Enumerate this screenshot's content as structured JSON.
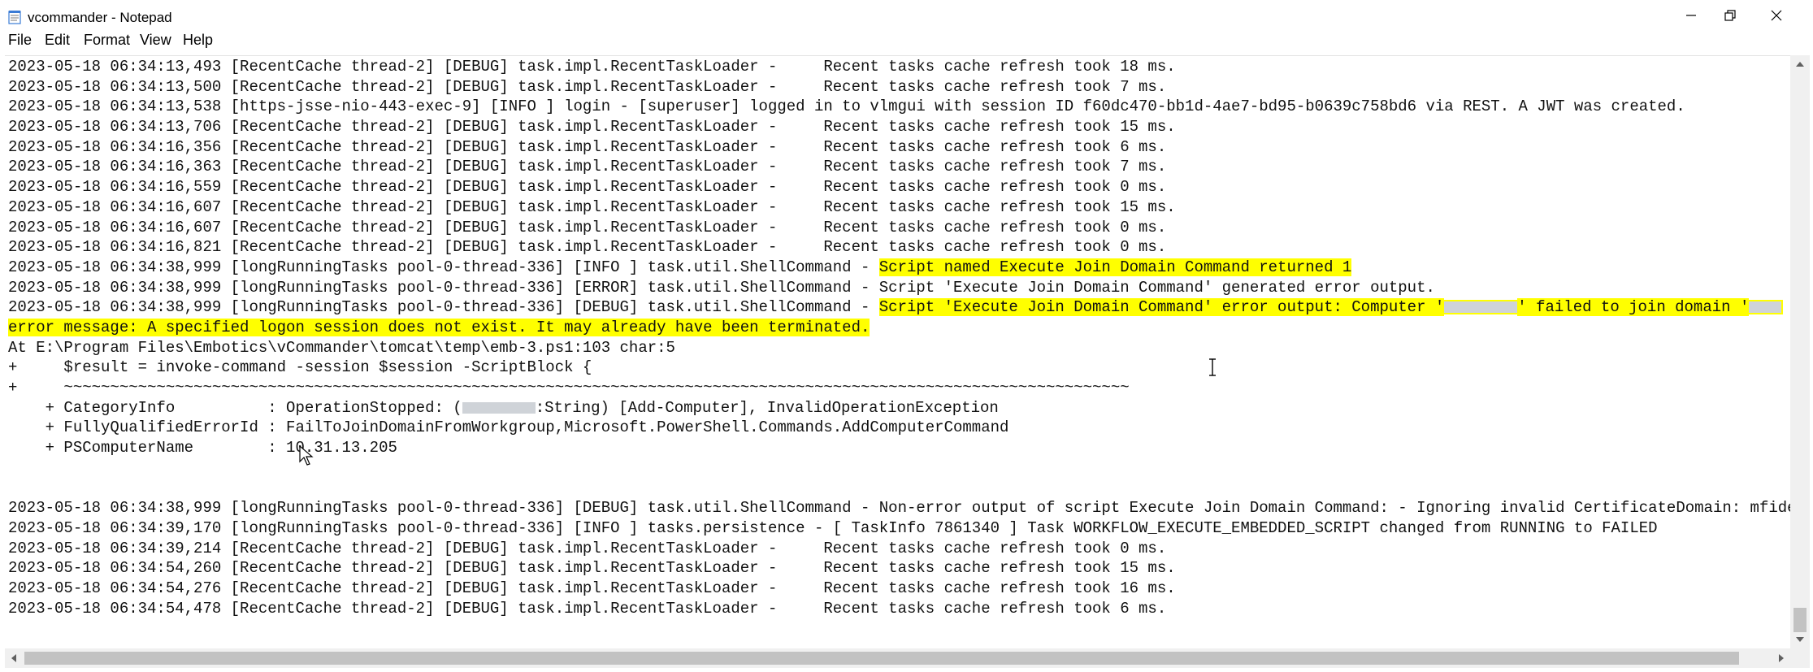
{
  "window": {
    "title": "vcommander - Notepad"
  },
  "menu": [
    "File",
    "Edit",
    "Format",
    "View",
    "Help"
  ],
  "log": {
    "lines": [
      {
        "segments": [
          {
            "text": "2023-05-18 06:34:13,493 [RecentCache thread-2] [DEBUG] task.impl.RecentTaskLoader -     Recent tasks cache refresh took 18 ms."
          }
        ]
      },
      {
        "segments": [
          {
            "text": "2023-05-18 06:34:13,500 [RecentCache thread-2] [DEBUG] task.impl.RecentTaskLoader -     Recent tasks cache refresh took 7 ms."
          }
        ]
      },
      {
        "segments": [
          {
            "text": "2023-05-18 06:34:13,538 [https-jsse-nio-443-exec-9] [INFO ] login - [superuser] logged in to vlmgui with session ID f60dc470-bb1d-4ae7-bd95-b0639c758bd6 via REST. A JWT was created."
          }
        ]
      },
      {
        "segments": [
          {
            "text": "2023-05-18 06:34:13,706 [RecentCache thread-2] [DEBUG] task.impl.RecentTaskLoader -     Recent tasks cache refresh took 15 ms."
          }
        ]
      },
      {
        "segments": [
          {
            "text": "2023-05-18 06:34:16,356 [RecentCache thread-2] [DEBUG] task.impl.RecentTaskLoader -     Recent tasks cache refresh took 6 ms."
          }
        ]
      },
      {
        "segments": [
          {
            "text": "2023-05-18 06:34:16,363 [RecentCache thread-2] [DEBUG] task.impl.RecentTaskLoader -     Recent tasks cache refresh took 7 ms."
          }
        ]
      },
      {
        "segments": [
          {
            "text": "2023-05-18 06:34:16,559 [RecentCache thread-2] [DEBUG] task.impl.RecentTaskLoader -     Recent tasks cache refresh took 0 ms."
          }
        ]
      },
      {
        "segments": [
          {
            "text": "2023-05-18 06:34:16,607 [RecentCache thread-2] [DEBUG] task.impl.RecentTaskLoader -     Recent tasks cache refresh took 15 ms."
          }
        ]
      },
      {
        "segments": [
          {
            "text": "2023-05-18 06:34:16,607 [RecentCache thread-2] [DEBUG] task.impl.RecentTaskLoader -     Recent tasks cache refresh took 0 ms."
          }
        ]
      },
      {
        "segments": [
          {
            "text": "2023-05-18 06:34:16,821 [RecentCache thread-2] [DEBUG] task.impl.RecentTaskLoader -     Recent tasks cache refresh took 0 ms."
          }
        ]
      },
      {
        "segments": [
          {
            "text": "2023-05-18 06:34:38,999 [longRunningTasks pool-0-thread-336] [INFO ] task.util.ShellCommand - "
          },
          {
            "text": "Script named Execute Join Domain Command returned 1",
            "hl": true
          }
        ]
      },
      {
        "segments": [
          {
            "text": "2023-05-18 06:34:38,999 [longRunningTasks pool-0-thread-336] [ERROR] task.util.ShellCommand - Script 'Execute Join Domain Command' generated error output."
          }
        ]
      },
      {
        "segments": [
          {
            "text": "2023-05-18 06:34:38,999 [longRunningTasks pool-0-thread-336] [DEBUG] task.util.ShellCommand - "
          },
          {
            "text": "Script 'Execute Join Domain Command' error output: Computer '",
            "hl": true
          },
          {
            "redact": true,
            "hl": true
          },
          {
            "text": "' failed to join domain '",
            "hl": true
          },
          {
            "redact": true,
            "small": true,
            "hl": true
          }
        ]
      },
      {
        "segments": [
          {
            "text": "error message: A specified logon session does not exist. It may already have been terminated.",
            "hl": true
          }
        ]
      },
      {
        "segments": [
          {
            "text": "At E:\\Program Files\\Embotics\\vCommander\\tomcat\\temp\\emb-3.ps1:103 char:5"
          }
        ]
      },
      {
        "segments": [
          {
            "text": "+     $result = invoke-command -session $session -ScriptBlock {"
          }
        ]
      },
      {
        "segments": [
          {
            "text": "+     ~~~~~~~~~~~~~~~~~~~~~~~~~~~~~~~~~~~~~~~~~~~~~~~~~~~~~~~~~~~~~~~~~~~~~~~~~~~~~~~~~~~~~~~~~~~~~~~~~~~~~~~~~~~~~~~~~~~"
          }
        ]
      },
      {
        "segments": [
          {
            "text": "    + CategoryInfo          : OperationStopped: ("
          },
          {
            "redact": true
          },
          {
            "text": ":String) [Add-Computer], InvalidOperationException"
          }
        ]
      },
      {
        "segments": [
          {
            "text": "    + FullyQualifiedErrorId : FailToJoinDomainFromWorkgroup,Microsoft.PowerShell.Commands.AddComputerCommand"
          }
        ]
      },
      {
        "segments": [
          {
            "text": "    + PSComputerName        : 10.31.13.205"
          }
        ]
      },
      {
        "segments": [
          {
            "text": " "
          }
        ]
      },
      {
        "segments": [
          {
            "text": " "
          }
        ]
      },
      {
        "segments": [
          {
            "text": "2023-05-18 06:34:38,999 [longRunningTasks pool-0-thread-336] [DEBUG] task.util.ShellCommand - Non-error output of script Execute Join Domain Command: - Ignoring invalid CertificateDomain: mfidev.net"
          }
        ]
      },
      {
        "segments": [
          {
            "text": "2023-05-18 06:34:39,170 [longRunningTasks pool-0-thread-336] [INFO ] tasks.persistence - [ TaskInfo 7861340 ] Task WORKFLOW_EXECUTE_EMBEDDED_SCRIPT changed from RUNNING to FAILED"
          }
        ]
      },
      {
        "segments": [
          {
            "text": "2023-05-18 06:34:39,214 [RecentCache thread-2] [DEBUG] task.impl.RecentTaskLoader -     Recent tasks cache refresh took 0 ms."
          }
        ]
      },
      {
        "segments": [
          {
            "text": "2023-05-18 06:34:54,260 [RecentCache thread-2] [DEBUG] task.impl.RecentTaskLoader -     Recent tasks cache refresh took 15 ms."
          }
        ]
      },
      {
        "segments": [
          {
            "text": "2023-05-18 06:34:54,276 [RecentCache thread-2] [DEBUG] task.impl.RecentTaskLoader -     Recent tasks cache refresh took 16 ms."
          }
        ]
      },
      {
        "segments": [
          {
            "text": "2023-05-18 06:34:54,478 [RecentCache thread-2] [DEBUG] task.impl.RecentTaskLoader -     Recent tasks cache refresh took 6 ms."
          }
        ]
      }
    ]
  },
  "colors": {
    "highlight": "#ffff00",
    "text": "#111111",
    "scrollbar": "#f0f0f0",
    "thumb": "#c2c2c2"
  },
  "icons": {
    "app": "notepad-icon",
    "minimize": "minimize-icon",
    "maximize": "restore-icon",
    "close": "close-icon"
  }
}
